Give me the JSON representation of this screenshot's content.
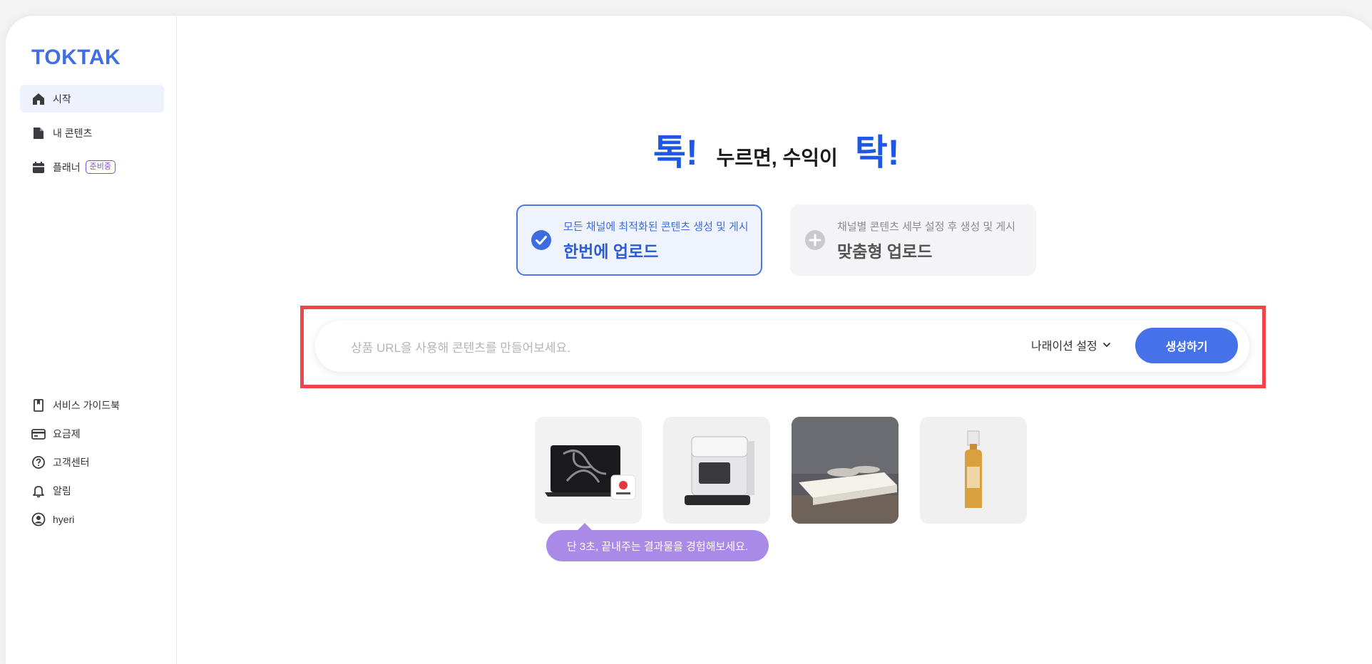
{
  "sidebar": {
    "logo": "TOKTAK",
    "items": [
      {
        "label": "시작",
        "icon": "home-icon"
      },
      {
        "label": "내 콘텐츠",
        "icon": "document-icon"
      },
      {
        "label": "플래너",
        "icon": "calendar-icon",
        "badge": "준비중"
      }
    ],
    "bottom_items": [
      {
        "label": "서비스 가이드북",
        "icon": "book-icon"
      },
      {
        "label": "요금제",
        "icon": "credit-card-icon"
      },
      {
        "label": "고객센터",
        "icon": "help-circle-icon"
      },
      {
        "label": "알림",
        "icon": "bell-icon"
      },
      {
        "label": "hyeri",
        "icon": "user-avatar-icon"
      }
    ]
  },
  "hero": {
    "word1": "톡!",
    "middle": "누르면, 수익이",
    "word2": "탁!"
  },
  "modes": [
    {
      "subtitle": "모든 채널에 최적화된 콘텐츠 생성 및 게시",
      "title": "한번에 업로드",
      "selected": true,
      "icon": "check-circle-icon"
    },
    {
      "subtitle": "채널별 콘텐츠 세부 설정 후 생성 및 게시",
      "title": "맞춤형 업로드",
      "selected": false,
      "icon": "plus-circle-icon"
    }
  ],
  "search": {
    "placeholder": "상품 URL을 사용해 콘텐츠를 만들어보세요.",
    "narration_label": "나래이션 설정",
    "generate_label": "생성하기"
  },
  "samples": [
    {
      "name": "laptop-product"
    },
    {
      "name": "robot-vacuum-product"
    },
    {
      "name": "mattress-product"
    },
    {
      "name": "serum-bottle-product"
    }
  ],
  "tooltip": "단 3초, 끝내주는 결과물을 경험해보세요.",
  "colors": {
    "accent": "#4572e8",
    "highlight": "#f0454b",
    "tooltip": "#a98ae6",
    "badge": "#7c4ddb"
  }
}
